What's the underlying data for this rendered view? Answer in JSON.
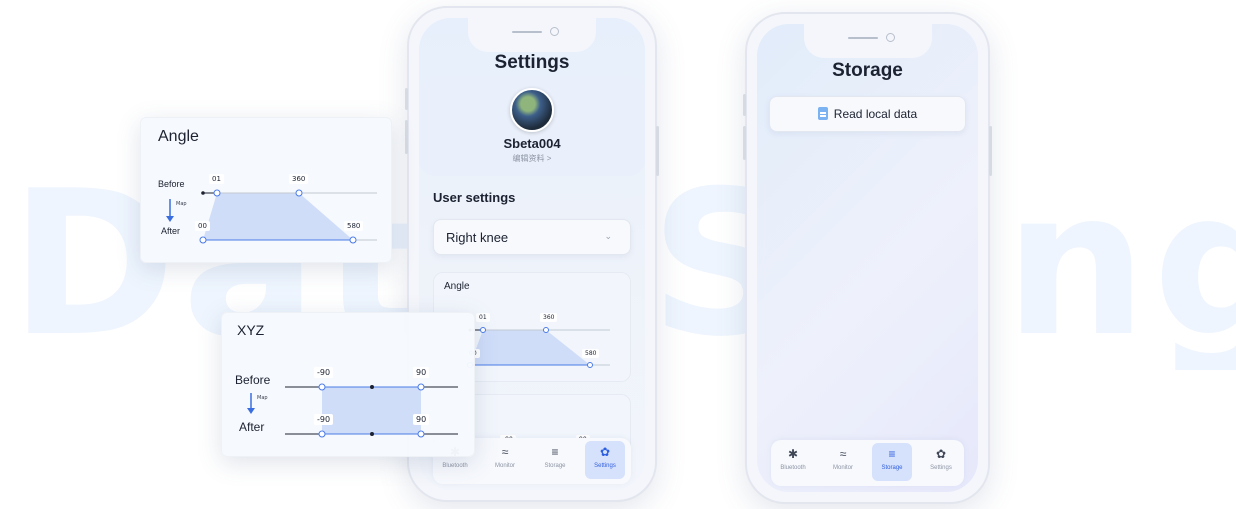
{
  "background_words": [
    "Data",
    "Se",
    "ing"
  ],
  "colors": {
    "accent": "#2e5fe0",
    "active_tab_bg": "#d6e1fb",
    "slider_fill": "#c8d8f8"
  },
  "angle_card": {
    "title": "Angle",
    "before_label": "Before",
    "after_label": "After",
    "map_label": "Map",
    "before_min": "01",
    "before_max": "360",
    "after_min": "00",
    "after_max": "580"
  },
  "xyz_card": {
    "title": "XYZ",
    "before_label": "Before",
    "after_label": "After",
    "map_label": "Map",
    "before_min": "-90",
    "before_max": "90",
    "after_min": "-90",
    "after_max": "90"
  },
  "settings_phone": {
    "title": "Settings",
    "username": "Sbeta004",
    "edit_profile": "编辑资料 >",
    "section_title": "User settings",
    "joint_select": "Right knee",
    "angle_section": {
      "title": "Angle",
      "before_min": "01",
      "before_max": "360",
      "after_min": "00",
      "after_max": "580"
    },
    "xyz_section": {
      "min": "-90",
      "max": "90"
    },
    "tabs": [
      {
        "label": "Bluetooth",
        "icon": "bluetooth-icon",
        "active": false
      },
      {
        "label": "Monitor",
        "icon": "monitor-icon",
        "active": false
      },
      {
        "label": "Storage",
        "icon": "storage-icon",
        "active": false
      },
      {
        "label": "Settings",
        "icon": "settings-gear-icon",
        "active": true
      }
    ]
  },
  "storage_phone": {
    "title": "Storage",
    "read_button": "Read local data",
    "tabs": [
      {
        "label": "Bluetooth",
        "icon": "bluetooth-icon",
        "active": false
      },
      {
        "label": "Monitor",
        "icon": "monitor-icon",
        "active": false
      },
      {
        "label": "Storage",
        "icon": "storage-icon",
        "active": true
      },
      {
        "label": "Settings",
        "icon": "settings-gear-icon",
        "active": false
      }
    ]
  }
}
